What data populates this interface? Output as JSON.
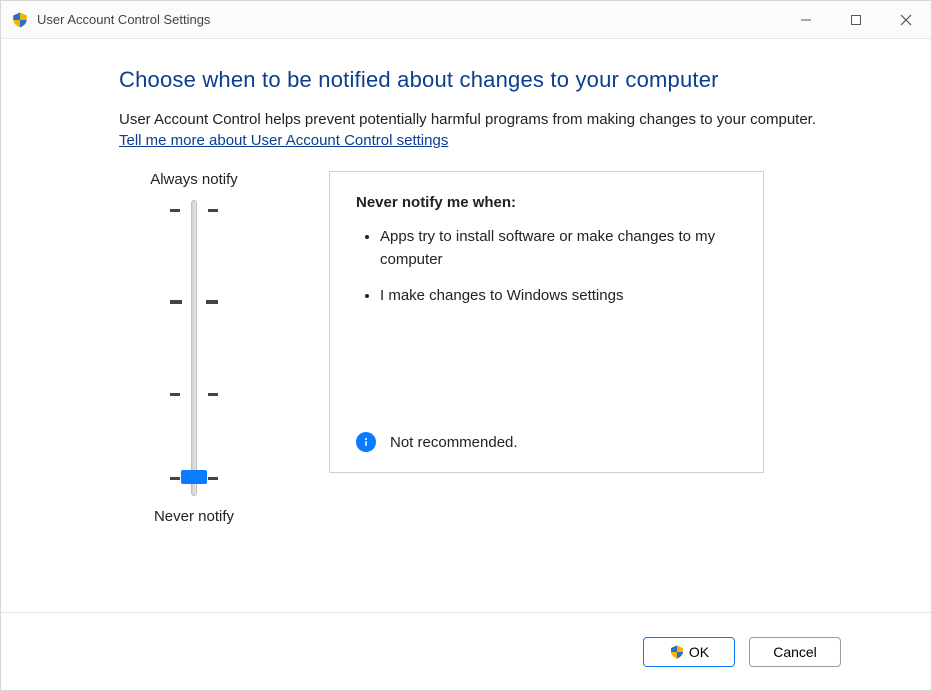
{
  "window": {
    "title": "User Account Control Settings"
  },
  "heading": "Choose when to be notified about changes to your computer",
  "description": "User Account Control helps prevent potentially harmful programs from making changes to your computer.",
  "link_text": "Tell me more about User Account Control settings",
  "slider": {
    "top_label": "Always notify",
    "bottom_label": "Never notify",
    "levels": 4,
    "current_level": 3
  },
  "info": {
    "title": "Never notify me when:",
    "bullets": [
      "Apps try to install software or make changes to my computer",
      "I make changes to Windows settings"
    ],
    "footer_icon": "info-icon",
    "footer_text": "Not recommended."
  },
  "buttons": {
    "ok": "OK",
    "cancel": "Cancel"
  }
}
